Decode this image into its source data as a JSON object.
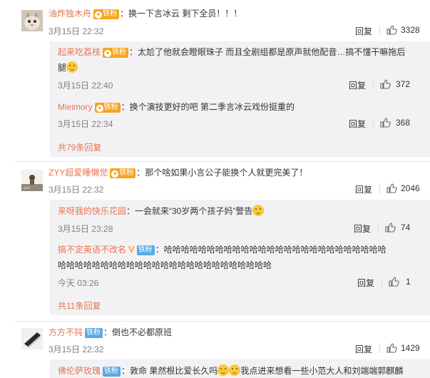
{
  "comments": [
    {
      "user": "油炸独木舟",
      "badge": "铁粉",
      "text": "：换一下言冰云 剩下全员！！！",
      "time": "3月15日 22:32",
      "reply": "回复",
      "likes": "3328",
      "replies": [
        {
          "user": "起来吃荔枝",
          "badge": "铁粉",
          "text": "：太尬了他就会瞪眼珠子 而且全剧组都是原声就他配音…搞不懂干嘛拖后",
          "text2": "腿",
          "time": "3月15日 22:40",
          "reply": "回复",
          "likes": "372"
        },
        {
          "user": "Mieimory",
          "badge": "铁粉",
          "text": "：换个演技更好的吧 第二季言冰云戏份挺重的",
          "time": "3月15日 22:34",
          "reply": "回复",
          "likes": "368"
        }
      ],
      "more": "共79条回复"
    },
    {
      "user": "ZYY超爱睡懒觉",
      "badge": "铁粉",
      "text": "：那个啥如果小言公子能换个人就更完美了！",
      "time": "3月15日 22:32",
      "reply": "回复",
      "likes": "2046",
      "replies": [
        {
          "user": "来呀我的快乐花园",
          "text": "：一会就来“30岁两个孩子妈”警告",
          "time": "3月15日 23:28",
          "reply": "回复",
          "likes": "74"
        },
        {
          "user": "搞不定英语不改名",
          "badge": "铁粉",
          "text": "：哈哈哈哈哈哈哈哈哈哈哈哈哈哈哈哈哈哈哈哈哈哈哈哈哈哈",
          "text2": "哈哈哈哈哈哈哈哈哈哈哈哈哈哈哈哈哈哈哈哈哈哈哈哈哈",
          "time": "今天 03:26",
          "reply": "回复",
          "likes": "1"
        }
      ],
      "more": "共11条回复"
    },
    {
      "user": "方方不钝",
      "badge": "铁粉",
      "text": "：倒也不必都原班",
      "time": "3月15日 22:32",
      "reply": "回复",
      "likes": "1429",
      "replies": [
        {
          "user": "佛伦萨玫瑰",
          "badge": "铁粉",
          "text": "：敦命 果然根比爱长久吗",
          "text2": "我点进来想看一些小范大人和刘端端郭麒麟",
          "time": "",
          "reply": "",
          "likes": ""
        }
      ]
    }
  ],
  "colors": {
    "username": "#eb7350",
    "badge_gold": "#f7a420",
    "badge_blue": "#5aa9e6",
    "sub_bg": "#f2f2f5"
  }
}
